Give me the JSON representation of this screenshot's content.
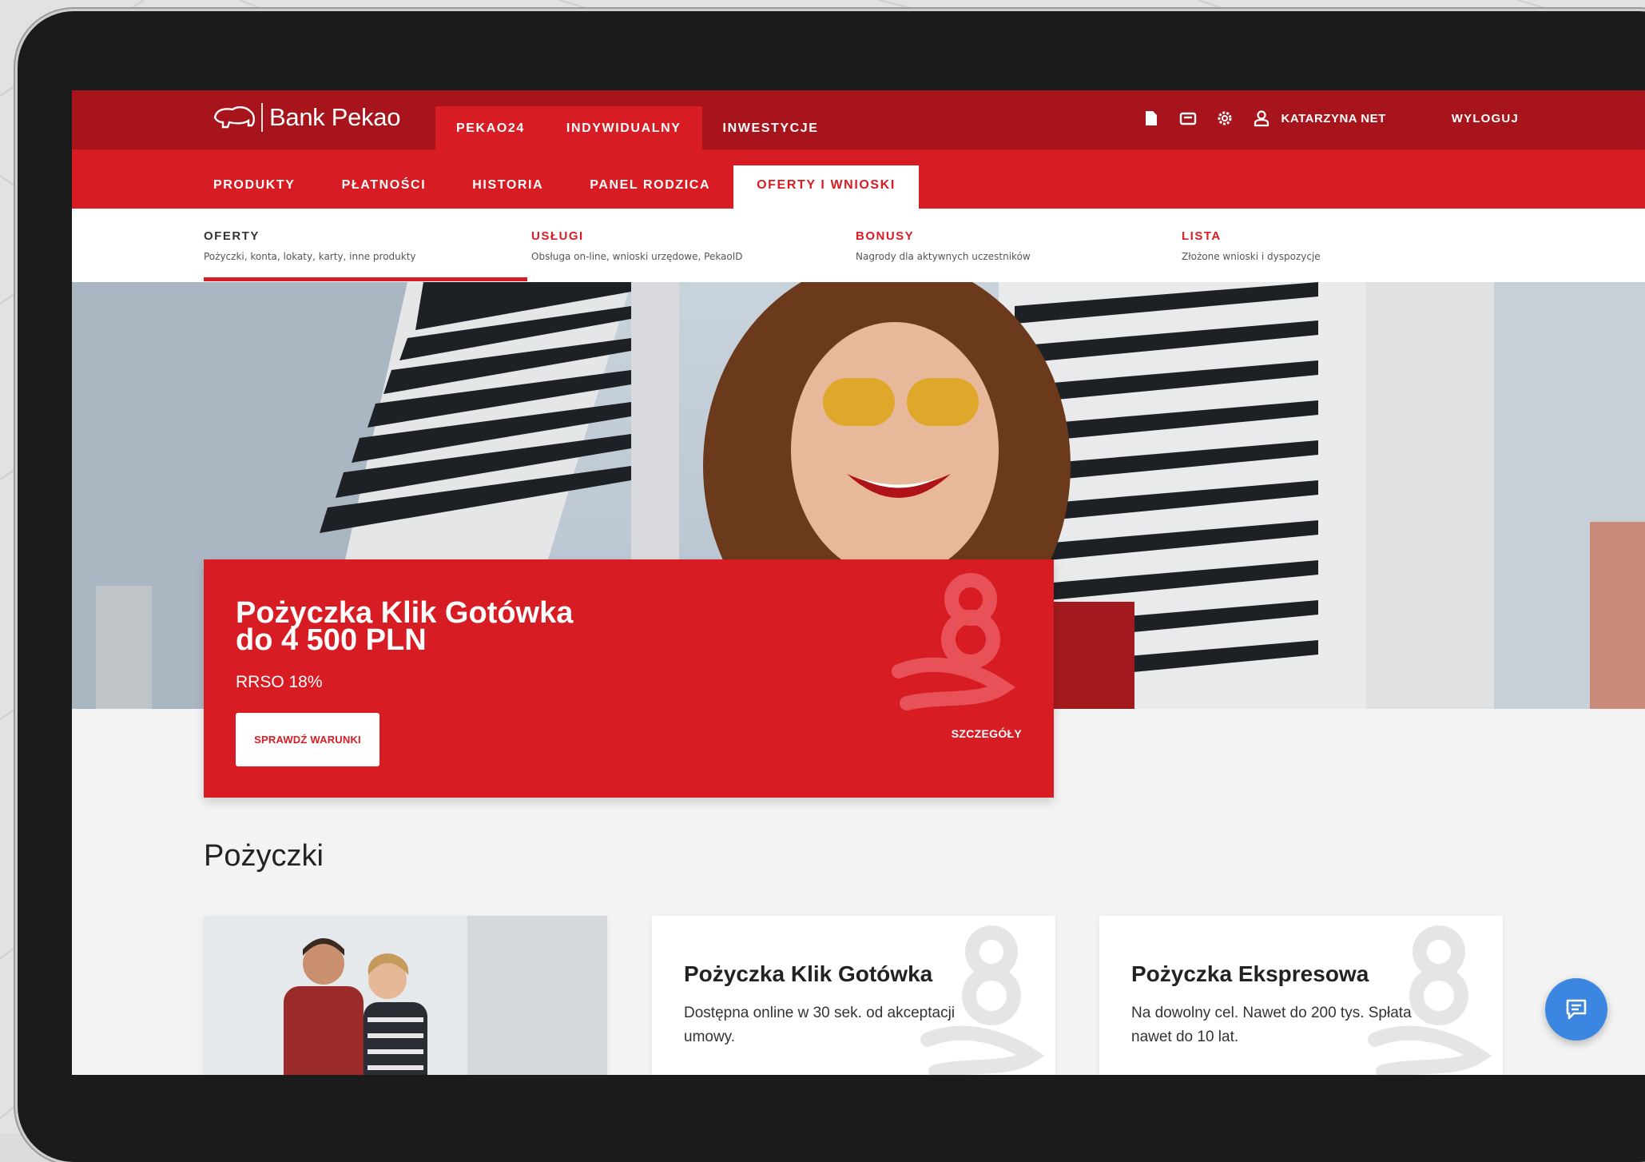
{
  "brand": {
    "name": "Bank Pekao"
  },
  "top_tabs": [
    {
      "label": "PEKAO24"
    },
    {
      "label": "INDYWIDUALNY"
    },
    {
      "label": "INWESTYCJE"
    }
  ],
  "user_bar": {
    "icons": [
      "document-icon",
      "mail-icon",
      "settings-icon",
      "user-icon"
    ],
    "user_name": "KATARZYNA NET",
    "logout": "WYLOGUJ"
  },
  "subnav": [
    {
      "label": "PRODUKTY"
    },
    {
      "label": "PŁATNOŚCI"
    },
    {
      "label": "HISTORIA"
    },
    {
      "label": "PANEL RODZICA"
    },
    {
      "label": "OFERTY I WNIOSKI"
    }
  ],
  "third_nav": [
    {
      "title": "OFERTY",
      "subtitle": "Pożyczki, konta, lokaty, karty, inne produkty"
    },
    {
      "title": "USŁUGI",
      "subtitle": "Obsługa on-line, wnioski urzędowe, PekaoID"
    },
    {
      "title": "BONUSY",
      "subtitle": "Nagrody dla aktywnych uczestników"
    },
    {
      "title": "LISTA",
      "subtitle": "Złożone wnioski i dyspozycje"
    }
  ],
  "promo": {
    "title_line1": "Pożyczka Klik Gotówka",
    "title_line2": "do 4 500 PLN",
    "rrso": "RRSO 18%",
    "button": "SPRAWDŹ WARUNKI",
    "details": "SZCZEGÓŁY"
  },
  "section": {
    "title": "Pożyczki"
  },
  "cards": [
    {
      "title": "Pożyczka Klik Gotówka",
      "desc": "Dostępna online w 30 sek. od akceptacji umowy."
    },
    {
      "title": "Pożyczka Ekspresowa",
      "desc": "Na dowolny cel. Nawet do 200 tys. Spłata nawet do 10 lat."
    }
  ],
  "colors": {
    "dark_red": "#a8141b",
    "red": "#d81c23",
    "chat_blue": "#3a86e0"
  }
}
